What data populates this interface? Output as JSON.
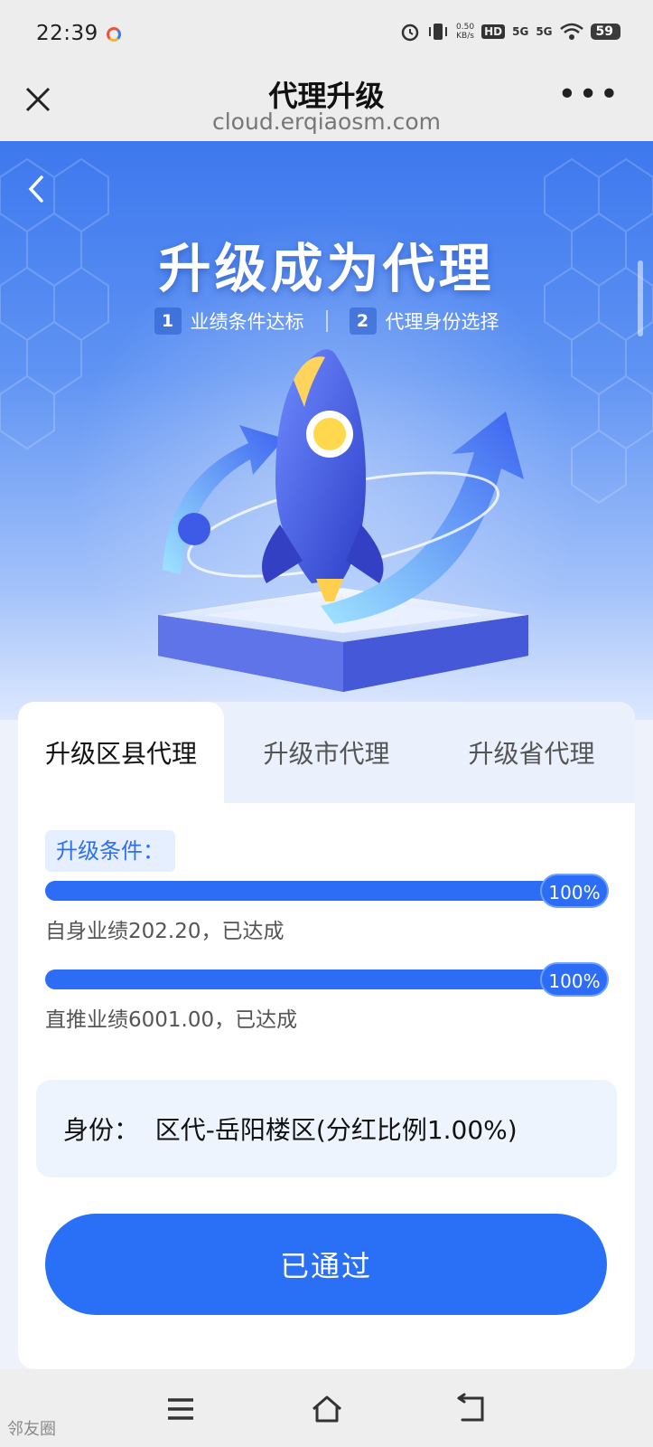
{
  "status_bar": {
    "time": "22:39",
    "net_speed_value": "0.50",
    "net_speed_unit": "KB/s",
    "hd_label": "HD",
    "sig1": "5G",
    "sig2": "5G",
    "battery": "59"
  },
  "nav": {
    "title": "代理升级",
    "url": "cloud.erqiaosm.com",
    "more": "•••"
  },
  "hero": {
    "title": "升级成为代理",
    "steps": [
      {
        "num": "1",
        "label": "业绩条件达标"
      },
      {
        "num": "2",
        "label": "代理身份选择"
      }
    ]
  },
  "tabs": [
    {
      "label": "升级区县代理",
      "active": true
    },
    {
      "label": "升级市代理",
      "active": false
    },
    {
      "label": "升级省代理",
      "active": false
    }
  ],
  "conditions": {
    "badge": "升级条件：",
    "items": [
      {
        "percent_label": "100%",
        "progress": 1.0,
        "text": "自身业绩202.20，已达成"
      },
      {
        "percent_label": "100%",
        "progress": 1.0,
        "text": "直推业绩6001.00，已达成"
      }
    ]
  },
  "identity": {
    "text": "身份：  区代-岳阳楼区(分红比例1.00%)"
  },
  "action_button": "已通过",
  "watermark": "邻友圈",
  "colors": {
    "primary": "#2a70f7",
    "tab_bg": "#eaf1fd",
    "hero_top": "#3d78ee"
  }
}
